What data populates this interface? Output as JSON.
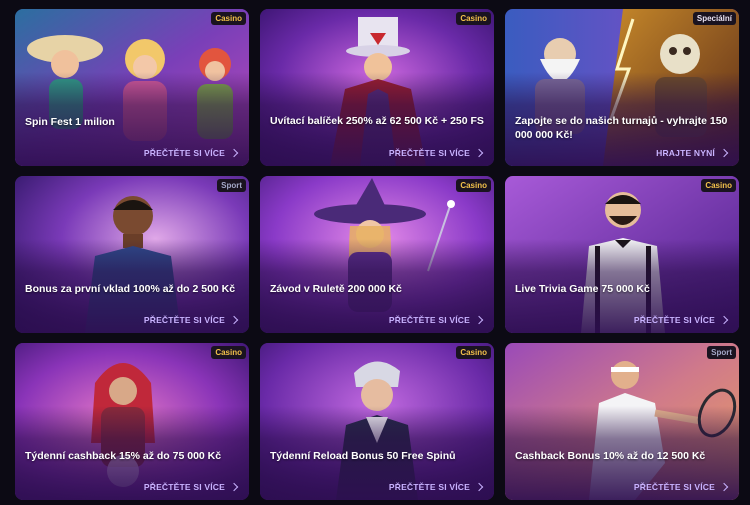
{
  "promotions": [
    {
      "badge": "Casino",
      "title": "Spin Fest 1 milion",
      "cta": "PŘEČTĚTE SI VÍCE"
    },
    {
      "badge": "Casino",
      "title": "Uvítací balíček 250% až 62 500 Kč + 250 FS",
      "cta": "PŘEČTĚTE SI VÍCE"
    },
    {
      "badge": "Speciální",
      "title": "Zapojte se do našich turnajů - vyhrajte 150 000 000 Kč!",
      "cta": "HRAJTE NYNÍ"
    },
    {
      "badge": "Sport",
      "title": "Bonus za první vklad 100% až do 2 500 Kč",
      "cta": "PŘEČTĚTE SI VÍCE"
    },
    {
      "badge": "Casino",
      "title": "Závod v Ruletě 200 000 Kč",
      "cta": "PŘEČTĚTE SI VÍCE"
    },
    {
      "badge": "Casino",
      "title": "Live Trivia Game 75 000 Kč",
      "cta": "PŘEČTĚTE SI VÍCE"
    },
    {
      "badge": "Casino",
      "title": "Týdenní cashback 15% až do 75 000 Kč",
      "cta": "PŘEČTĚTE SI VÍCE"
    },
    {
      "badge": "Casino",
      "title": "Týdenní Reload Bonus 50 Free Spinů",
      "cta": "PŘEČTĚTE SI VÍCE"
    },
    {
      "badge": "Sport",
      "title": "Cashback Bonus 10% až do 12 500 Kč",
      "cta": "PŘEČTĚTE SI VÍCE"
    }
  ],
  "colors": {
    "page_bg": "#0c0a14",
    "card_purple": "#4a1f86",
    "casino_badge": "#f2c14a",
    "cta": "#c9b3ff"
  }
}
